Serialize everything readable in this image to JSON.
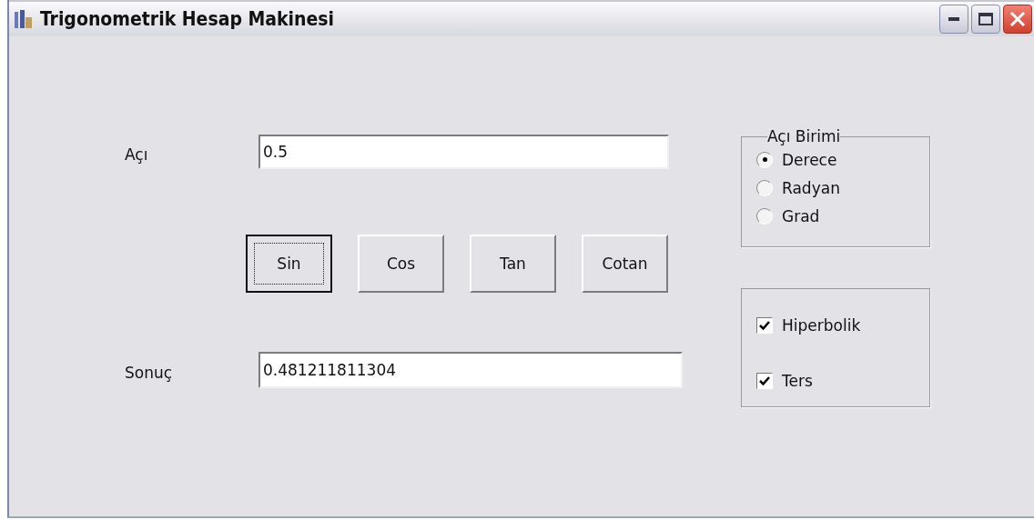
{
  "window": {
    "title": "Trigonometrik Hesap Makinesi"
  },
  "angle": {
    "label": "Açı",
    "value": "0.5"
  },
  "functions": [
    {
      "label": "Sin",
      "focused": true
    },
    {
      "label": "Cos",
      "focused": false
    },
    {
      "label": "Tan",
      "focused": false
    },
    {
      "label": "Cotan",
      "focused": false
    }
  ],
  "result": {
    "label": "Sonuç",
    "value": "0.481211811304"
  },
  "unit_group": {
    "title": "Açı Birimi",
    "options": [
      {
        "label": "Derece",
        "selected": true
      },
      {
        "label": "Radyan",
        "selected": false
      },
      {
        "label": "Grad",
        "selected": false
      }
    ]
  },
  "options": [
    {
      "label": "Hiperbolik",
      "checked": true
    },
    {
      "label": "Ters",
      "checked": true
    }
  ]
}
